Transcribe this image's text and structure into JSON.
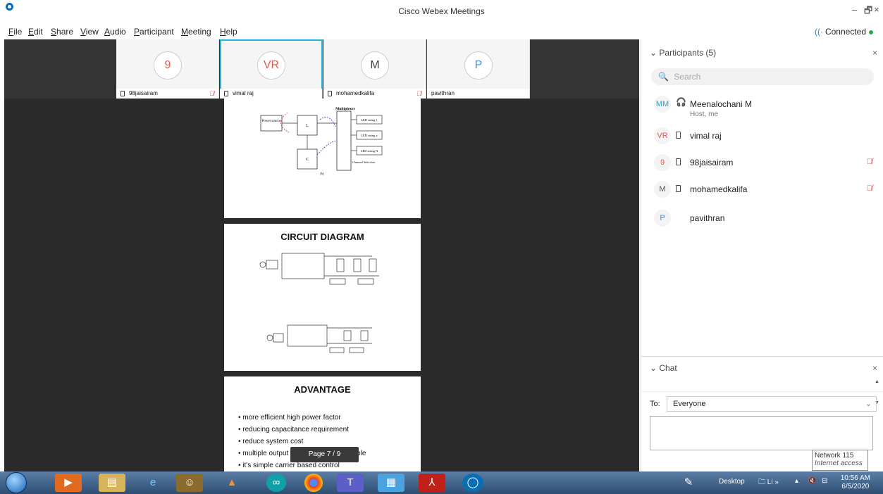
{
  "window": {
    "title": "Cisco Webex Meetings",
    "min": "–",
    "max": "🗗",
    "close": "×"
  },
  "menu": [
    "File",
    "Edit",
    "Share",
    "View",
    "Audio",
    "Participant",
    "Meeting",
    "Help"
  ],
  "menu_underline": [
    "F",
    "E",
    "S",
    "V",
    "A",
    "P",
    "M",
    "H"
  ],
  "status": {
    "label": "Connected"
  },
  "video_tiles": [
    {
      "initials": "9",
      "name": "98jaisairam",
      "color": "#e05a4e",
      "muted": true
    },
    {
      "initials": "VR",
      "name": "vimal raj",
      "color": "#e05a4e",
      "muted": false,
      "active": true
    },
    {
      "initials": "M",
      "name": "mohamedkalifa",
      "color": "#444444",
      "muted": true
    },
    {
      "initials": "P",
      "name": "pavithran",
      "color": "#3a8fd8",
      "muted": false
    }
  ],
  "slides": {
    "figure_label": "(b)",
    "multiplexer_label": "Multiplexer",
    "power_source": "Power source",
    "led_strings": [
      "LED string 1",
      "LED string x",
      "LED string N"
    ],
    "channel_selection": "Channel Selection",
    "circuit_title": "CIRCUIT DIAGRAM",
    "advantage_title": "ADVANTAGE",
    "advantages": [
      "more efficient high power factor",
      "reducing capacitance requirement",
      "reduce system cost",
      "multiple output application are available",
      "it's simple carrier based control"
    ]
  },
  "pager": {
    "text": "Page   7  /  9"
  },
  "participants_panel": {
    "title": "Participants (5)",
    "close": "×",
    "search_placeholder": "Search",
    "people": [
      {
        "initials": "MM",
        "name": "Meenalochani M",
        "sub": "Host, me",
        "color": "#3a9fb8",
        "device": "headset",
        "muted": false
      },
      {
        "initials": "VR",
        "name": "vimal raj",
        "sub": "",
        "color": "#e05a4e",
        "device": "phone",
        "muted": false
      },
      {
        "initials": "9",
        "name": "98jaisairam",
        "sub": "",
        "color": "#e05a4e",
        "device": "phone",
        "muted": true
      },
      {
        "initials": "M",
        "name": "mohamedkalifa",
        "sub": "",
        "color": "#555555",
        "device": "phone",
        "muted": true
      },
      {
        "initials": "P",
        "name": "pavithran",
        "sub": "",
        "color": "#3a8fd8",
        "device": "none",
        "muted": false
      }
    ]
  },
  "chat_panel": {
    "title": "Chat",
    "close": "×",
    "to_label": "To:",
    "to_value": "Everyone"
  },
  "tooltip": {
    "line1": "Network 115",
    "line2": "Internet access"
  },
  "taskbar": {
    "desktop_label": "Desktop",
    "li_label": "Li",
    "time": "10:56 AM",
    "date": "6/5/2020"
  }
}
